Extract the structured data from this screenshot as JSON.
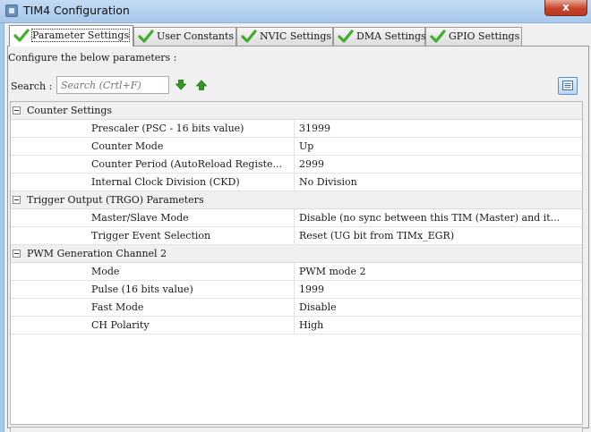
{
  "window": {
    "title": "TIM4 Configuration",
    "close_label": "x"
  },
  "tabs": [
    {
      "label": "Parameter Settings",
      "active": true
    },
    {
      "label": "User Constants",
      "active": false
    },
    {
      "label": "NVIC Settings",
      "active": false
    },
    {
      "label": "DMA Settings",
      "active": false
    },
    {
      "label": "GPIO Settings",
      "active": false
    }
  ],
  "panel": {
    "configure_text": "Configure the below parameters :",
    "search_label": "Search :",
    "search_placeholder": "Search (Crtl+F)"
  },
  "groups": [
    {
      "title": "Counter Settings",
      "params": [
        {
          "name": "Prescaler (PSC - 16 bits value)",
          "value": "31999"
        },
        {
          "name": "Counter Mode",
          "value": "Up"
        },
        {
          "name": "Counter Period (AutoReload Registe...",
          "value": "2999"
        },
        {
          "name": "Internal Clock Division (CKD)",
          "value": "No Division"
        }
      ]
    },
    {
      "title": "Trigger Output (TRGO) Parameters",
      "params": [
        {
          "name": "Master/Slave Mode",
          "value": "Disable (no sync between this TIM (Master) and it..."
        },
        {
          "name": "Trigger Event Selection",
          "value": "Reset (UG bit from TIMx_EGR)"
        }
      ]
    },
    {
      "title": "PWM Generation Channel 2",
      "params": [
        {
          "name": "Mode",
          "value": "PWM mode 2"
        },
        {
          "name": "Pulse (16 bits value)",
          "value": "1999"
        },
        {
          "name": "Fast Mode",
          "value": "Disable"
        },
        {
          "name": "CH Polarity",
          "value": "High"
        }
      ]
    }
  ],
  "colors": {
    "check_green": "#3fae2a",
    "arrow_green": "#2e9a1e",
    "title_bar": "#a7c7ea",
    "close_red": "#c8442a"
  },
  "icons": {
    "app": "app-icon",
    "tab_check": "checkmark-icon",
    "find_next": "arrow-down-icon",
    "find_prev": "arrow-up-icon",
    "list_view": "list-view-icon"
  }
}
